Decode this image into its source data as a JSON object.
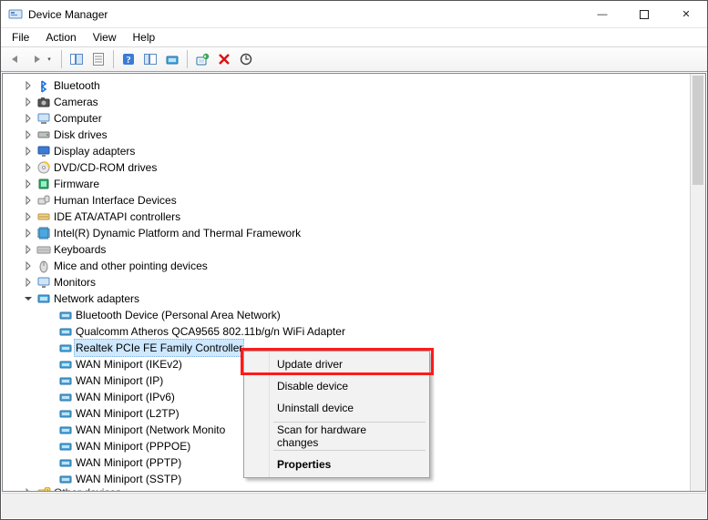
{
  "window": {
    "title": "Device Manager",
    "btn_min": "—",
    "btn_max": "▢",
    "btn_close": "✕"
  },
  "menu": {
    "file": "File",
    "action": "Action",
    "view": "View",
    "help": "Help"
  },
  "toolbar": {
    "back": "back",
    "forward": "forward",
    "show_hide": "show-hide-console-tree",
    "properties": "properties",
    "help": "help",
    "show_hidden": "show-hidden-devices",
    "update": "update-driver",
    "uninstall": "uninstall-device",
    "disable": "disable-device",
    "scan": "scan-hardware"
  },
  "tree": {
    "categories": [
      {
        "label": "Bluetooth",
        "icon": "bluetooth"
      },
      {
        "label": "Cameras",
        "icon": "camera"
      },
      {
        "label": "Computer",
        "icon": "computer"
      },
      {
        "label": "Disk drives",
        "icon": "disk"
      },
      {
        "label": "Display adapters",
        "icon": "display"
      },
      {
        "label": "DVD/CD-ROM drives",
        "icon": "disc"
      },
      {
        "label": "Firmware",
        "icon": "firmware"
      },
      {
        "label": "Human Interface Devices",
        "icon": "hid"
      },
      {
        "label": "IDE ATA/ATAPI controllers",
        "icon": "ide"
      },
      {
        "label": "Intel(R) Dynamic Platform and Thermal Framework",
        "icon": "intel"
      },
      {
        "label": "Keyboards",
        "icon": "keyboard"
      },
      {
        "label": "Mice and other pointing devices",
        "icon": "mouse"
      },
      {
        "label": "Monitors",
        "icon": "monitor"
      },
      {
        "label": "Network adapters",
        "icon": "network",
        "expanded": true,
        "children": [
          {
            "label": "Bluetooth Device (Personal Area Network)"
          },
          {
            "label": "Qualcomm Atheros QCA9565 802.11b/g/n WiFi Adapter"
          },
          {
            "label": "Realtek PCIe FE Family Controller",
            "selected": true
          },
          {
            "label": "WAN Miniport (IKEv2)"
          },
          {
            "label": "WAN Miniport (IP)"
          },
          {
            "label": "WAN Miniport (IPv6)"
          },
          {
            "label": "WAN Miniport (L2TP)"
          },
          {
            "label": "WAN Miniport (Network Monito"
          },
          {
            "label": "WAN Miniport (PPPOE)"
          },
          {
            "label": "WAN Miniport (PPTP)"
          },
          {
            "label": "WAN Miniport (SSTP)"
          }
        ]
      },
      {
        "label": "Other devices",
        "icon": "other",
        "partial": true
      }
    ]
  },
  "context_menu": {
    "items": [
      {
        "label": "Update driver",
        "highlighted": true
      },
      {
        "label": "Disable device"
      },
      {
        "label": "Uninstall device"
      },
      {
        "sep": true
      },
      {
        "label": "Scan for hardware changes"
      },
      {
        "sep": true
      },
      {
        "label": "Properties",
        "bold": true
      }
    ]
  }
}
